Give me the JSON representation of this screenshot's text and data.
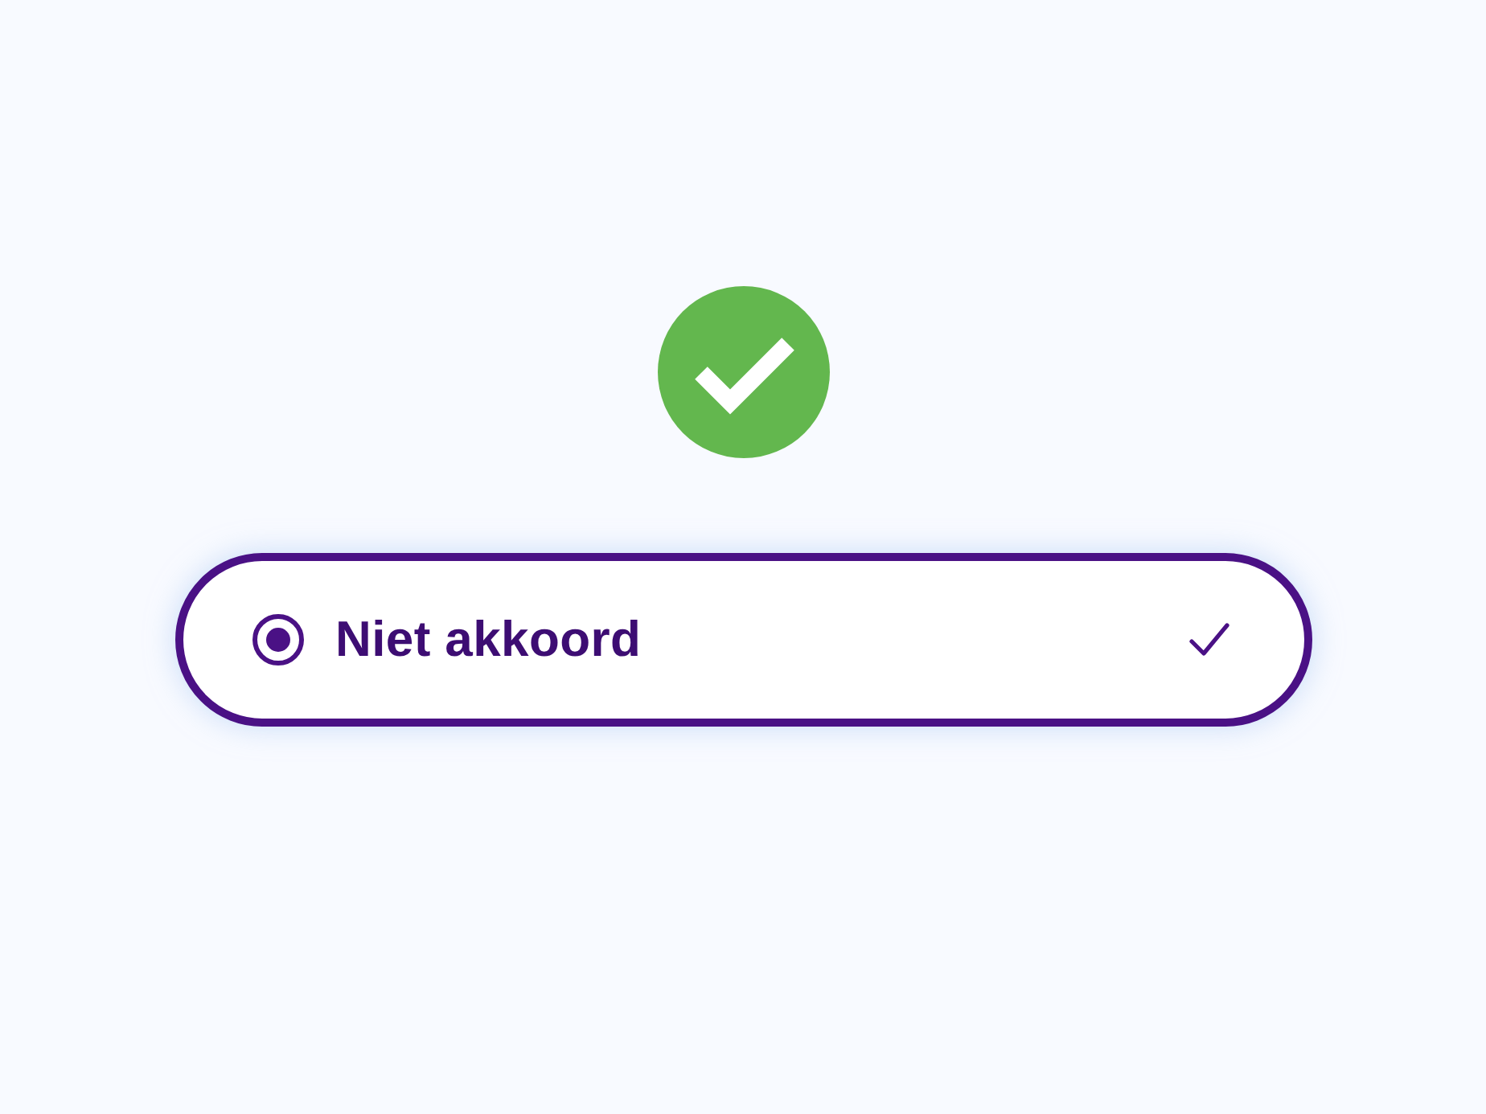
{
  "status": {
    "kind": "success"
  },
  "option": {
    "label": "Niet akkoord",
    "selected": true
  }
}
